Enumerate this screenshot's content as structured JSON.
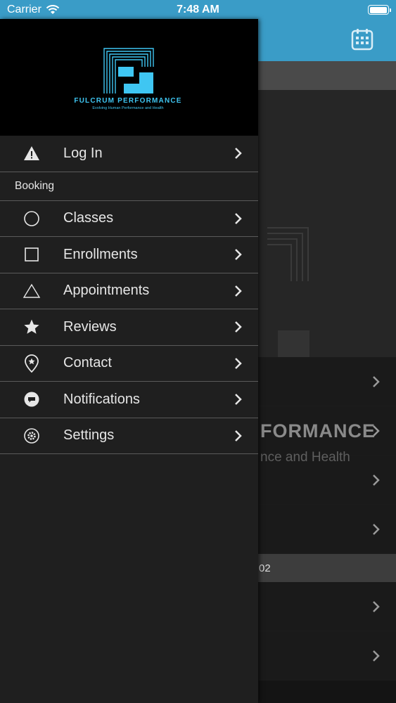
{
  "status_bar": {
    "carrier": "Carrier",
    "time": "7:48 AM"
  },
  "colors": {
    "header": "#3a9cc7",
    "accent": "#3fc6f2",
    "drawer": "#1f1f1f"
  },
  "drawer": {
    "logo": {
      "title": "FULCRUM PERFORMANCE",
      "subtitle": "Evolving Human Performance and Health"
    },
    "login": {
      "label": "Log In",
      "icon": "warning-icon"
    },
    "section": "Booking",
    "items": [
      {
        "label": "Classes",
        "icon": "circle-icon"
      },
      {
        "label": "Enrollments",
        "icon": "square-icon"
      },
      {
        "label": "Appointments",
        "icon": "triangle-icon"
      },
      {
        "label": "Reviews",
        "icon": "star-icon"
      },
      {
        "label": "Contact",
        "icon": "location-pin-icon"
      },
      {
        "label": "Notifications",
        "icon": "chat-bubble-icon"
      },
      {
        "label": "Settings",
        "icon": "gear-icon"
      }
    ]
  },
  "background": {
    "brand_text": "FORMANCE",
    "brand_sub": "nce and Health",
    "section_text": "02"
  }
}
